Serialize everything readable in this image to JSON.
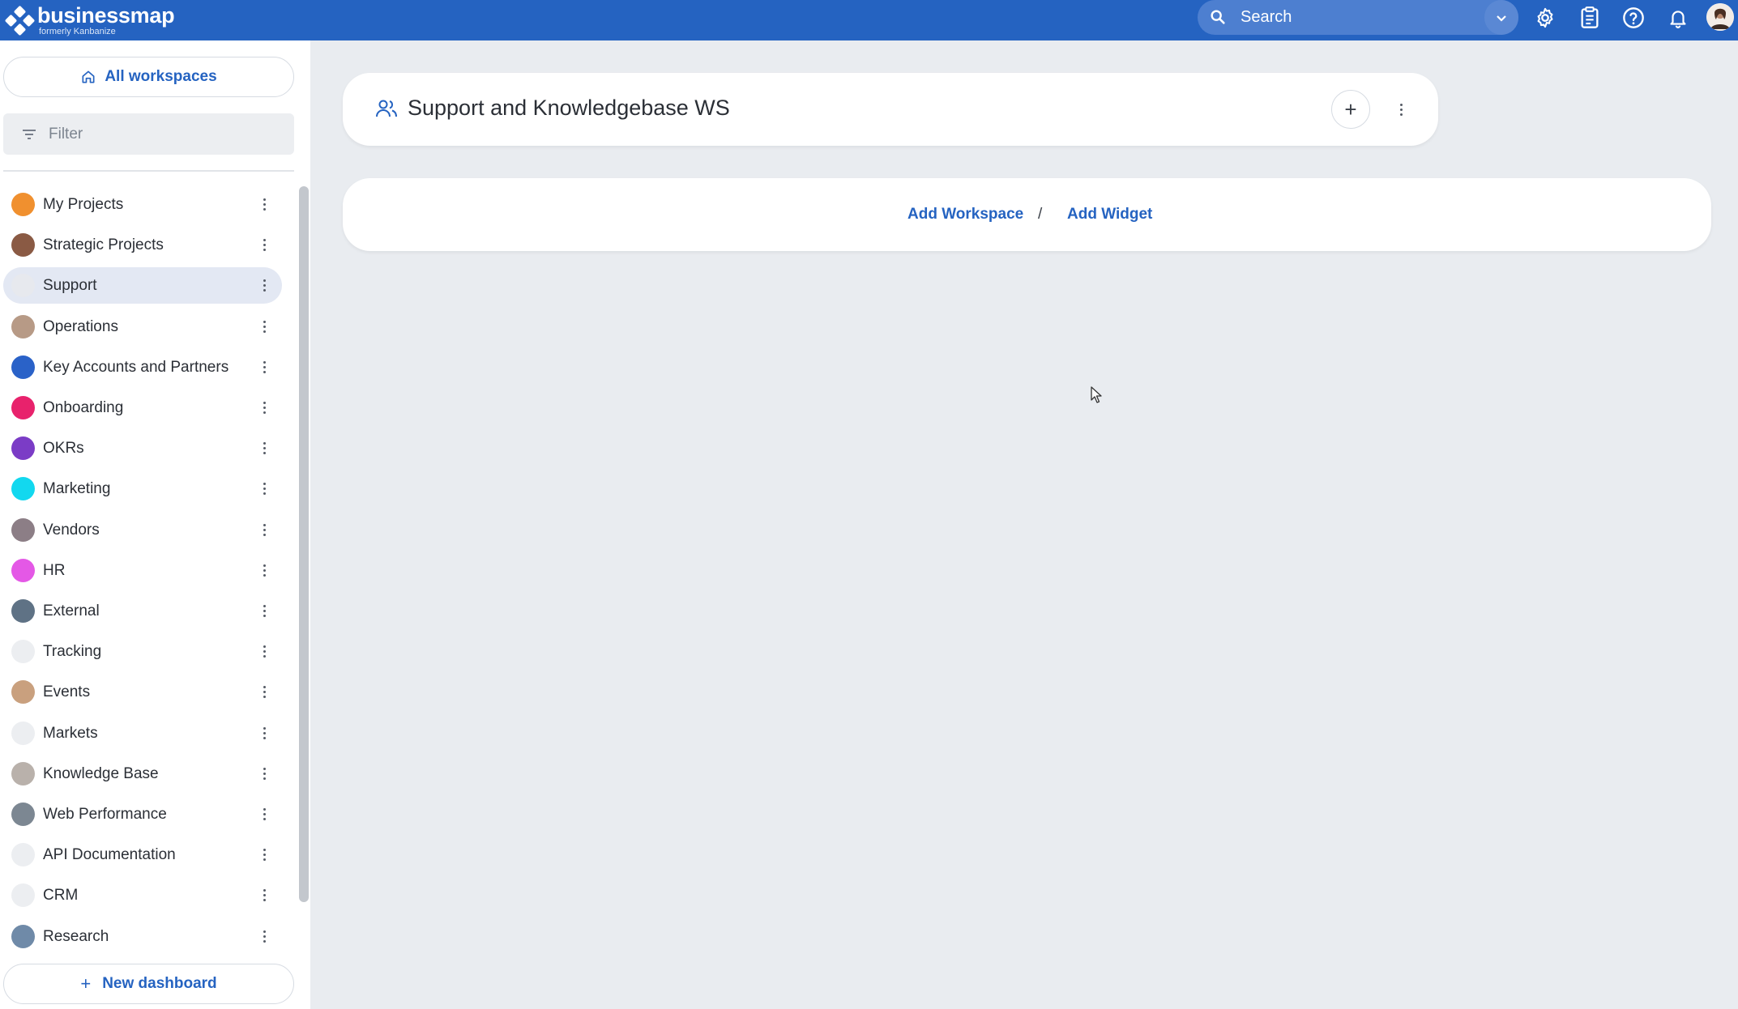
{
  "topbar": {
    "logo_name": "businessmap",
    "logo_sub": "formerly Kanbanize",
    "search_placeholder": "Search"
  },
  "sidebar": {
    "all_workspaces": "All workspaces",
    "filter_placeholder": "Filter",
    "items": [
      {
        "label": "My Projects",
        "color": "#f0902f",
        "active": false
      },
      {
        "label": "Strategic Projects",
        "color": "#8a5a44",
        "active": false
      },
      {
        "label": "Support",
        "color": "#e7e9ee",
        "active": true
      },
      {
        "label": "Operations",
        "color": "#b79a86",
        "active": false
      },
      {
        "label": "Key Accounts and Partners",
        "color": "#2a62c8",
        "active": false
      },
      {
        "label": "Onboarding",
        "color": "#e8226c",
        "active": false
      },
      {
        "label": "OKRs",
        "color": "#7b3cc6",
        "active": false
      },
      {
        "label": "Marketing",
        "color": "#12d8ef",
        "active": false
      },
      {
        "label": "Vendors",
        "color": "#8c7e86",
        "active": false
      },
      {
        "label": "HR",
        "color": "#e458e6",
        "active": false
      },
      {
        "label": "External",
        "color": "#5f7285",
        "active": false
      },
      {
        "label": "Tracking",
        "color": "#eceef1",
        "active": false
      },
      {
        "label": "Events",
        "color": "#c9a07e",
        "active": false
      },
      {
        "label": "Markets",
        "color": "#eceef1",
        "active": false
      },
      {
        "label": "Knowledge Base",
        "color": "#b9b1ab",
        "active": false
      },
      {
        "label": "Web Performance",
        "color": "#7c8792",
        "active": false
      },
      {
        "label": "API Documentation",
        "color": "#eceef1",
        "active": false
      },
      {
        "label": "CRM",
        "color": "#eceef1",
        "active": false
      },
      {
        "label": "Research",
        "color": "#6f8aa8",
        "active": false
      }
    ],
    "new_dashboard": "New dashboard"
  },
  "main": {
    "workspace_title": "Support and Knowledgebase WS",
    "add_workspace": "Add Workspace",
    "separator": "/",
    "add_widget": "Add Widget"
  }
}
